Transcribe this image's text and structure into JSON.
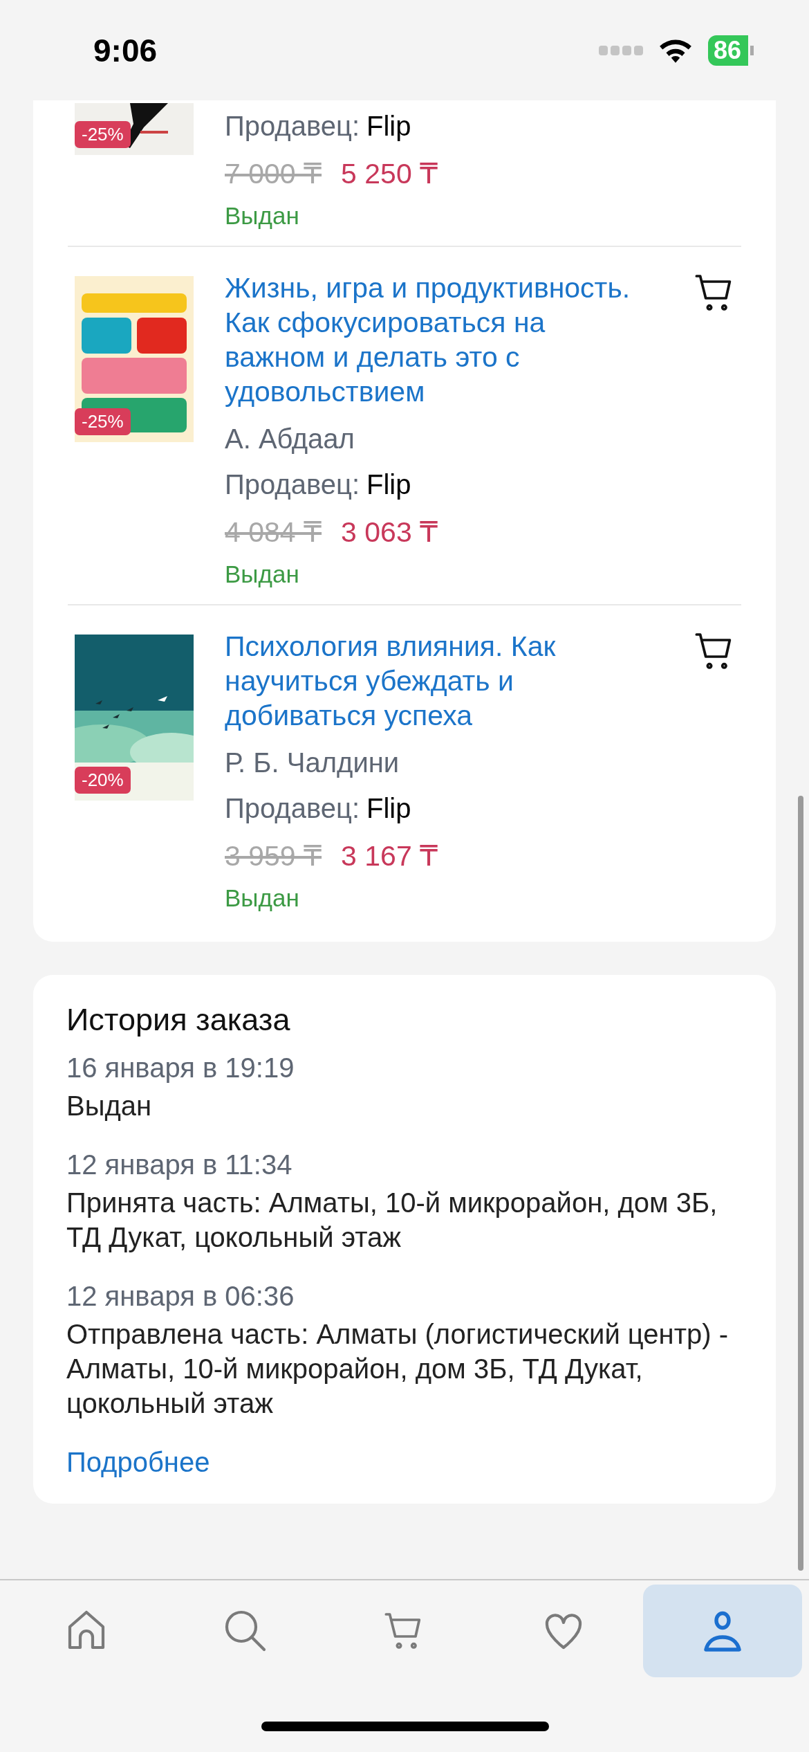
{
  "status_bar": {
    "time": "9:06",
    "battery": "86"
  },
  "order_items": [
    {
      "seller_label": "Продавец:",
      "seller": "Flip",
      "old_price": "7 000 ₸",
      "price": "5 250 ₸",
      "status": "Выдан",
      "discount": "-25%"
    },
    {
      "title": "Жизнь, игра и продуктивность. Как сфокусироваться на важном и делать это с удовольствием",
      "author": "А. Абдаал",
      "seller_label": "Продавец:",
      "seller": "Flip",
      "old_price": "4 084 ₸",
      "price": "3 063 ₸",
      "status": "Выдан",
      "discount": "-25%"
    },
    {
      "title": "Психология влияния. Как научиться убеждать и добиваться успеха",
      "author": "Р. Б. Чалдини",
      "seller_label": "Продавец:",
      "seller": "Flip",
      "old_price": "3 959 ₸",
      "price": "3 167 ₸",
      "status": "Выдан",
      "discount": "-20%"
    }
  ],
  "order_history": {
    "title": "История заказа",
    "events": [
      {
        "date": "16 января в 19:19",
        "text": "Выдан"
      },
      {
        "date": "12 января в 11:34",
        "text": "Принята часть: Алматы, 10-й микрорайон, дом 3Б, ТД Дукат, цокольный этаж"
      },
      {
        "date": "12 января в 06:36",
        "text": "Отправлена часть: Алматы (логистический центр) - Алматы, 10-й микрорайон, дом 3Б, ТД Дукат, цокольный этаж"
      }
    ],
    "more_link": "Подробнее"
  },
  "tab_bar": [
    {
      "kind": "home",
      "selected": false
    },
    {
      "kind": "search",
      "selected": false
    },
    {
      "kind": "cart",
      "selected": false
    },
    {
      "kind": "favorites",
      "selected": false
    },
    {
      "kind": "profile",
      "selected": true
    }
  ]
}
